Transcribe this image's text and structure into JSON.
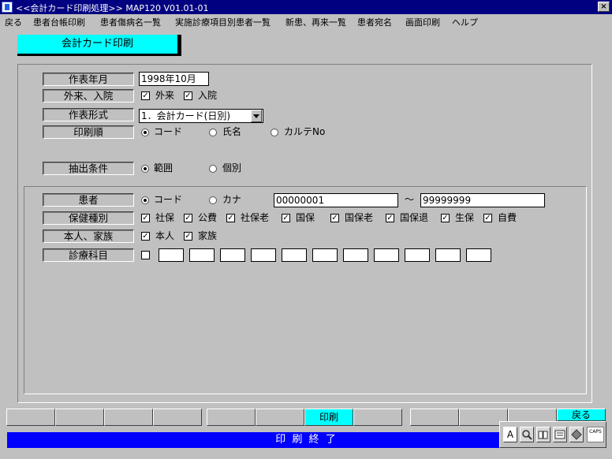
{
  "window": {
    "title": "<<会計カード印刷処理>> MAP120   V01.01-01",
    "close_label": "×"
  },
  "menu": [
    {
      "label": "戻る"
    },
    {
      "label": "患者台帳印刷"
    },
    {
      "label": "患者傷病名一覧"
    },
    {
      "label": "実施診療項目別患者一覧"
    },
    {
      "label": "新患、再来一覧"
    },
    {
      "label": "患者宛名"
    },
    {
      "label": "画面印刷"
    },
    {
      "label": "ヘルプ"
    }
  ],
  "screen_title": "会計カード印刷",
  "form": {
    "year_month": {
      "label": "作表年月",
      "value": "1998年10月"
    },
    "visit_type": {
      "label": "外来、入院",
      "outpatient": "外来",
      "inpatient": "入院"
    },
    "report_format": {
      "label": "作表形式",
      "value": "1．会計カード(日別)"
    },
    "print_order": {
      "label": "印刷順",
      "opt1": "コード",
      "opt2": "氏名",
      "opt3": "カルテNo"
    },
    "extract": {
      "label": "抽出条件",
      "opt1": "範囲",
      "opt2": "個別"
    }
  },
  "criteria": {
    "patient": {
      "label": "患者",
      "opt1": "コード",
      "opt2": "カナ",
      "from": "00000001",
      "tilde": "～",
      "to": "99999999"
    },
    "insurance": {
      "label": "保健種別",
      "items": [
        "社保",
        "公費",
        "社保老",
        "国保",
        "国保老",
        "国保退",
        "生保",
        "自費"
      ]
    },
    "self_family": {
      "label": "本人、家族",
      "opt1": "本人",
      "opt2": "家族"
    },
    "department": {
      "label": "診療科目"
    }
  },
  "fkeys": {
    "print": "印刷",
    "back": "戻る"
  },
  "status": "印 刷 終 了",
  "ime": {
    "mode": "A",
    "caps_label": "CAPS"
  }
}
